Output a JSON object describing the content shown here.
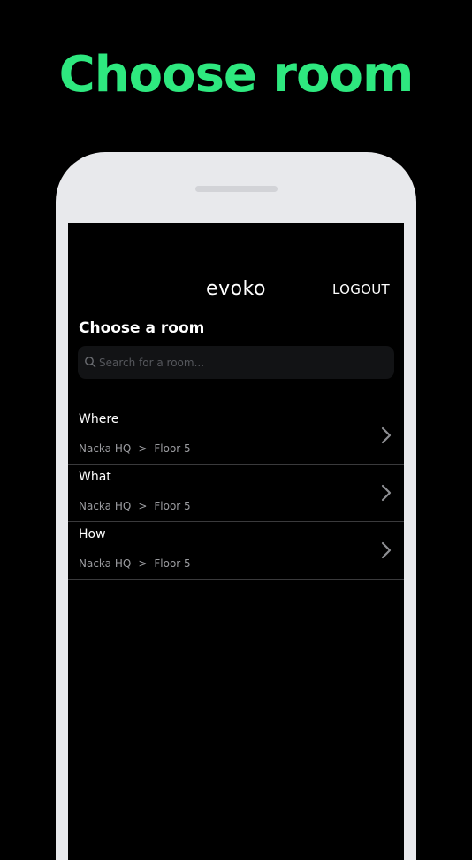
{
  "promo": {
    "headline": "Choose room",
    "headline_color": "#2ee87f"
  },
  "app": {
    "logo_text": "evoko",
    "logout_label": "LOGOUT",
    "section_title": "Choose a room",
    "search": {
      "placeholder": "Search for a room...",
      "value": "",
      "icon": "search-icon"
    },
    "rooms": [
      {
        "name": "Where",
        "location": "Nacka HQ",
        "separator": ">",
        "floor": "Floor 5",
        "icon": "chevron-right-icon"
      },
      {
        "name": "What",
        "location": "Nacka HQ",
        "separator": ">",
        "floor": "Floor 5",
        "icon": "chevron-right-icon"
      },
      {
        "name": "How",
        "location": "Nacka HQ",
        "separator": ">",
        "floor": "Floor 5",
        "icon": "chevron-right-icon"
      }
    ]
  },
  "colors": {
    "background": "#000000",
    "phone_frame": "#e8e9ec",
    "screen": "#000000",
    "search_field": "#121315",
    "divider": "#3a3a3c",
    "secondary_text": "#9b9ca0"
  }
}
